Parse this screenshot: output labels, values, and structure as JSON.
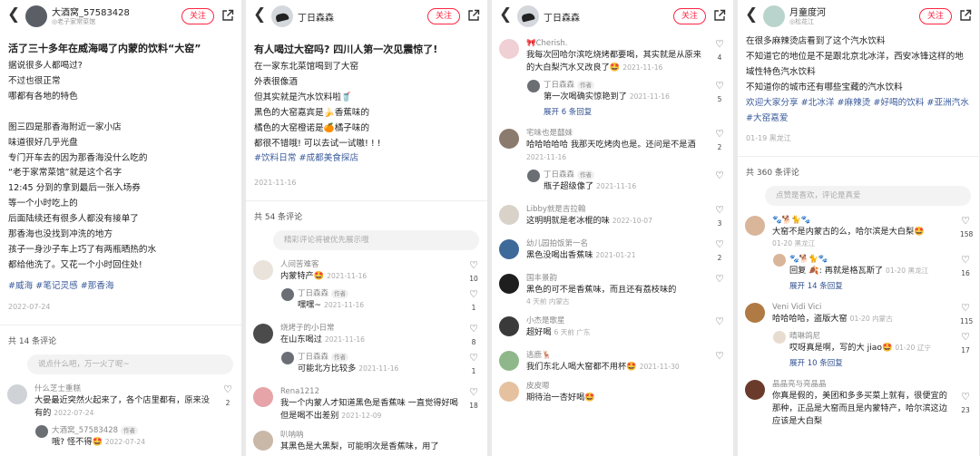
{
  "panels": [
    {
      "username": "大酒窝_57583428",
      "user_sub": "◎老子家常菜馆",
      "follow_label": "关注",
      "title": "活了三十多年在威海喝了内蒙的饮料“大窑”",
      "lines": [
        "据说很多人都喝过?",
        "不过也很正常",
        "哪都有各地的特色",
        "",
        "图三四是那香海附近一家小店",
        "味道很好几乎光盘",
        "专门开车去的因为那香海没什么吃的",
        "“老于家常菜馆”就是这个名字",
        "12:45 分到的拿到最后一张入场券",
        "等一个小时吃上的",
        "后面陆续还有很多人都没有接单了",
        "那香海也没找到冲洗的地方",
        "孩子一身沙子车上巧了有两瓶晒热的水",
        "都给他洗了。又花一个小时回住处!"
      ],
      "tags": "#威海  #笔记灵感  #那香海",
      "date": "2022-07-24",
      "comment_count": "共 14 条评论",
      "input_placeholder": "说点什么吧，万一火了呢~",
      "comments": [
        {
          "name": "什么芝士重糕",
          "text": "大晏最近突然火起来了，各个店里都有，原来没有的",
          "meta": "2022-07-24",
          "likes": "2",
          "reply": {
            "name": "大酒窝_57583428",
            "badge": "作者",
            "text": "哦? 怪不得🤩",
            "meta": "2022-07-24"
          }
        }
      ]
    },
    {
      "username": "丁日森森",
      "follow_label": "关注",
      "title": "有人喝过大窑吗? 四川人第一次见震惊了!",
      "lines": [
        "在一家东北菜馆喝到了大窑",
        "外表很像酒",
        "但其实就是汽水饮料啦🥤",
        "黑色的大窑嘉宾是🍌香蕉味的",
        "橘色的大窑橙诺是🍊橘子味的",
        "都很不错哦! 可以去试一试嗷! ! !"
      ],
      "tags": "#饮料日常  #成都美食探店",
      "date": "2021-11-16",
      "comment_count": "共 54 条评论",
      "input_placeholder": "精彩评论将被优先展示哦",
      "comments": [
        {
          "name": "人间苦难客",
          "text": "内蒙特产🤩",
          "meta": "2021-11-16",
          "likes": "10",
          "reply": {
            "name": "丁日森森",
            "badge": "作者",
            "text": "嘿嘿~",
            "meta": "2021-11-16",
            "likes": "1"
          }
        },
        {
          "name": "烧烤子的小日常",
          "text": "在山东喝过",
          "meta": "2021-11-16",
          "likes": "8",
          "reply": {
            "name": "丁日森森",
            "badge": "作者",
            "text": "可能北方比较多",
            "meta": "2021-11-16",
            "likes": "1"
          }
        },
        {
          "name": "Rena1212",
          "text": "我一个内蒙人才知道黑色是香蕉味 一直觉得好喝但是喝不出差别",
          "meta": "2021-12-09",
          "likes": "18"
        },
        {
          "name": "叭呐呐",
          "text": "其黑色是大黑梨，可能明次是香蕉味，用了",
          "meta": "",
          "likes": ""
        }
      ]
    },
    {
      "username": "丁日森森",
      "follow_label": "关注",
      "comments": [
        {
          "name": "🎀Cherish.",
          "text": "我每次回哈尔滨吃烧烤都要喝，其实就是从原来的大白梨汽水又改良了🤩",
          "meta": "2021-11-16",
          "likes": "4",
          "reply": {
            "name": "丁日森森",
            "badge": "作者",
            "text": "第一次喝确实惊艳到了",
            "meta": "2021-11-16",
            "likes": "5"
          },
          "more": "展开 6 条回复"
        },
        {
          "name": "宅味也是囍妹",
          "text": "哈哈哈哈哈 我那天吃烤肉也是。还问是不是酒",
          "meta": "2021-11-16",
          "likes": "2",
          "reply": {
            "name": "丁日森森",
            "badge": "作者",
            "text": "瓶子超级像了",
            "meta": "2021-11-16",
            "likes": ""
          }
        },
        {
          "name": "Libby就是吉拉翰",
          "text": "这明明就是老冰棍的味",
          "meta": "2022-10-07",
          "likes": "3"
        },
        {
          "name": "幼儿园拍饭第一名",
          "text": "黑色没喝出香蕉味",
          "meta": "2021-01-21",
          "likes": "2"
        },
        {
          "name": "国丰景韵",
          "text": "黑色的可不是香蕉味，而且还有荔枝味的",
          "meta": "4 天前 内蒙古",
          "likes": ""
        },
        {
          "name": "小杰是歌星",
          "text": "超好喝",
          "meta": "6 天前 广东",
          "likes": ""
        },
        {
          "name": "逃鹿🦌",
          "text": "我们东北人喝大窑都不用杯🤩",
          "meta": "2021-11-30",
          "likes": ""
        },
        {
          "name": "皮皮嗯",
          "text": "期待治一杏好喝🤩",
          "meta": "",
          "likes": ""
        }
      ]
    },
    {
      "username": "月童度河",
      "user_sub": "◎松花江",
      "follow_label": "关注",
      "lines": [
        "在很多麻辣烫店看到了这个汽水饮料",
        "不知道它的地位是不是跟北京北冰洋，西安冰锋这样的地域性特色汽水饮料",
        "不知道你的城市还有哪些宝藏的汽水饮料",
        "欢迎大家分享 #北冰洋 #麻辣烫 #好喝的饮料 #亚洲汽水 #大窑嘉爱"
      ],
      "date": "01-19 黑龙江",
      "comment_count": "共 360 条评论",
      "input_placeholder": "点赞是喜欢，评论是真爱",
      "comments": [
        {
          "name": "🐾🐕🐈🐾",
          "text": "大窑不是内蒙古的么，哈尔滨是大白梨🤩",
          "meta": "01-20 黑龙江",
          "likes": "158",
          "reply": {
            "name": "🐾🐕🐈🐾",
            "badge": "",
            "text": "回复 🍂: 再就是格瓦斯了",
            "meta": "01-20 黑龙江",
            "likes": "16"
          },
          "more": "展开 14 条回复"
        },
        {
          "name": "Veni Vidi Vici",
          "text": "哈哈哈哈，盗版大窑",
          "meta": "01-20 内蒙古",
          "likes": "115",
          "reply": {
            "name": "晴琳鸽尼",
            "badge": "",
            "text": "哎呀真是啊，写的大 jiao🤩",
            "meta": "01-20 辽宁",
            "likes": "17"
          },
          "more": "展开 10 条回复"
        },
        {
          "name": "晶晶亮与亮晶晶",
          "text": "你真是假的，美团和多多买菜上就有，很便宜的那种，正品是大窑而且是内蒙特产，哈尔滨这边应该是大白梨",
          "meta": "01-20 黑龙江",
          "likes": "23"
        }
      ]
    }
  ]
}
